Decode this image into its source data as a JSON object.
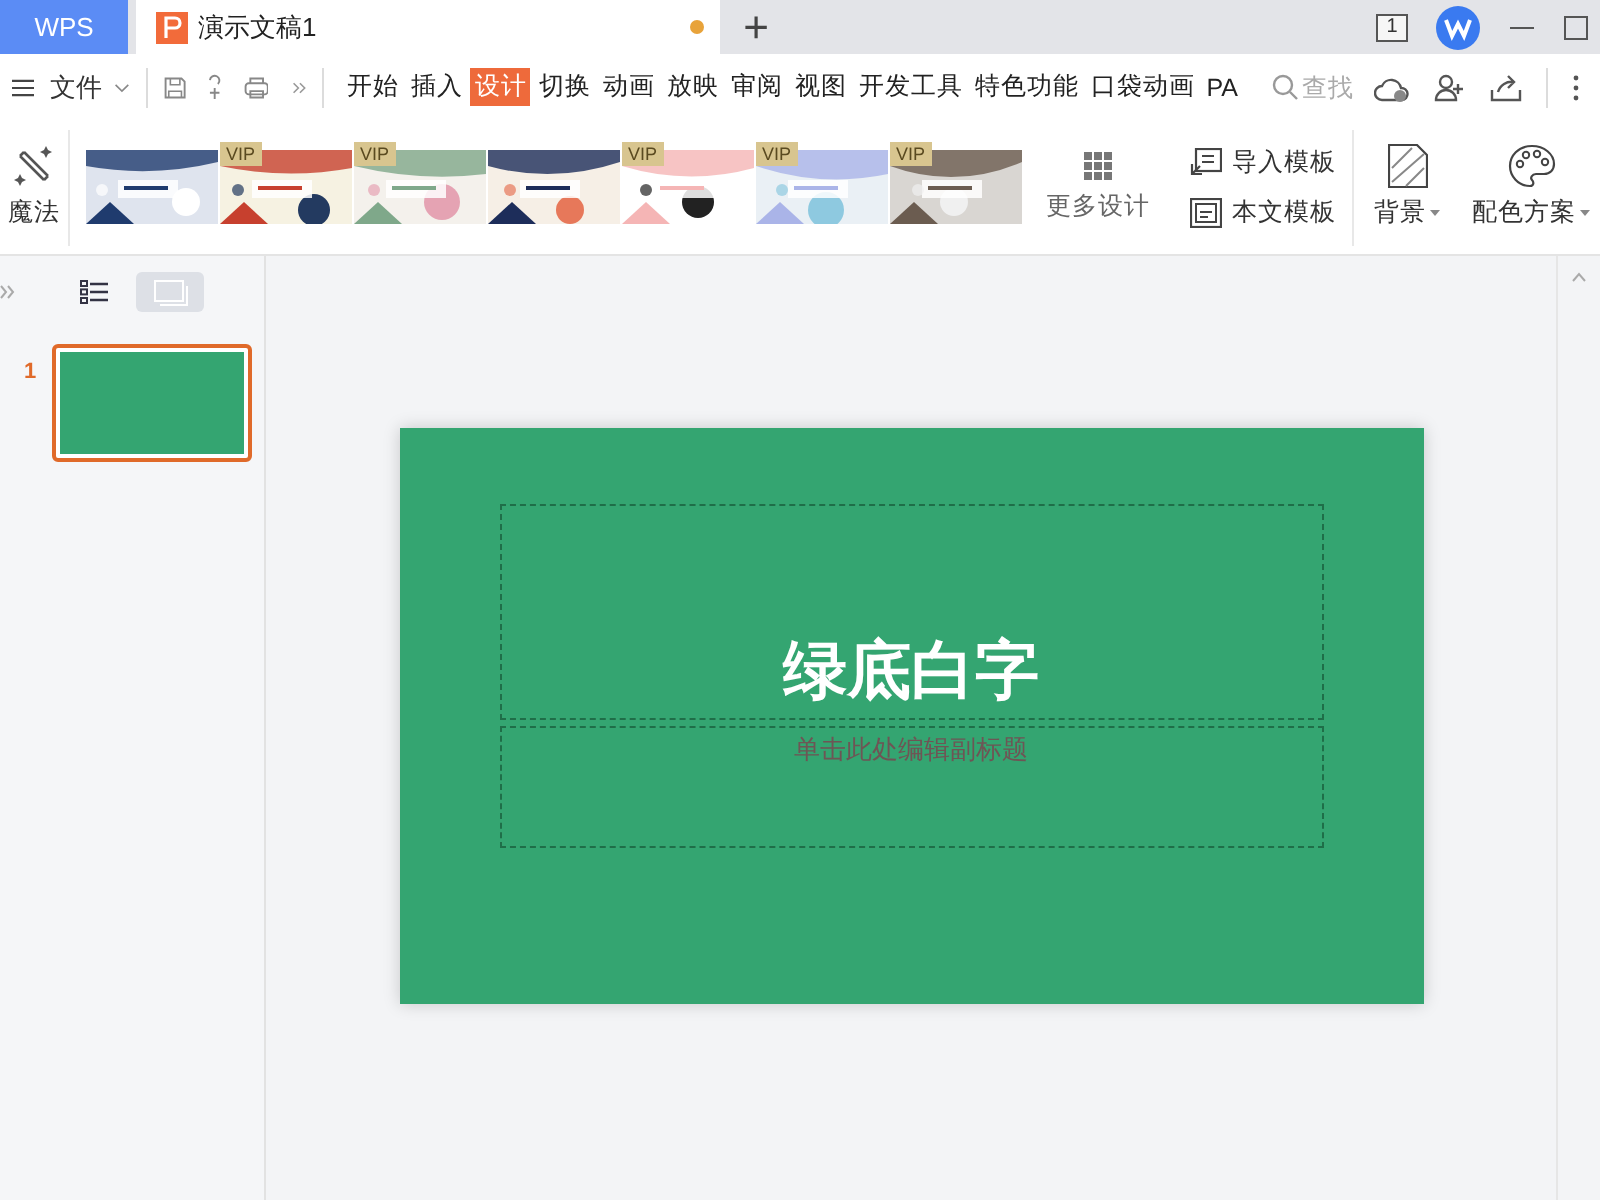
{
  "app_tab": "WPS",
  "doc_tab": {
    "title": "演示文稿1",
    "unsaved": true
  },
  "new_tab": "+",
  "window_count": "1",
  "menu": {
    "file": "文件",
    "search_placeholder": "查找",
    "tabs": [
      {
        "label": "开始",
        "selected": false
      },
      {
        "label": "插入",
        "selected": false
      },
      {
        "label": "设计",
        "selected": true
      },
      {
        "label": "切换",
        "selected": false
      },
      {
        "label": "动画",
        "selected": false
      },
      {
        "label": "放映",
        "selected": false
      },
      {
        "label": "审阅",
        "selected": false
      },
      {
        "label": "视图",
        "selected": false
      },
      {
        "label": "开发工具",
        "selected": false
      },
      {
        "label": "特色功能",
        "selected": false
      },
      {
        "label": "口袋动画",
        "selected": false
      },
      {
        "label": "PA",
        "selected": false
      }
    ]
  },
  "ribbon": {
    "magic": "魔法",
    "templates": [
      {
        "kind": "picture"
      },
      {
        "kind": "picture",
        "badge": "VIP"
      },
      {
        "kind": "picture",
        "badge": "VIP"
      },
      {
        "kind": "picture"
      },
      {
        "kind": "picture",
        "badge": "VIP"
      },
      {
        "kind": "picture",
        "badge": "VIP"
      },
      {
        "kind": "picture",
        "badge": "VIP"
      }
    ],
    "more_designs": "更多设计",
    "import_template": "导入模板",
    "document_template": "本文模板",
    "background": "背景",
    "color_scheme": "配色方案"
  },
  "slides": [
    {
      "number": "1",
      "selected": true
    }
  ],
  "slide": {
    "title": "绿底白字",
    "subtitle_placeholder": "单击此处编辑副标题"
  }
}
